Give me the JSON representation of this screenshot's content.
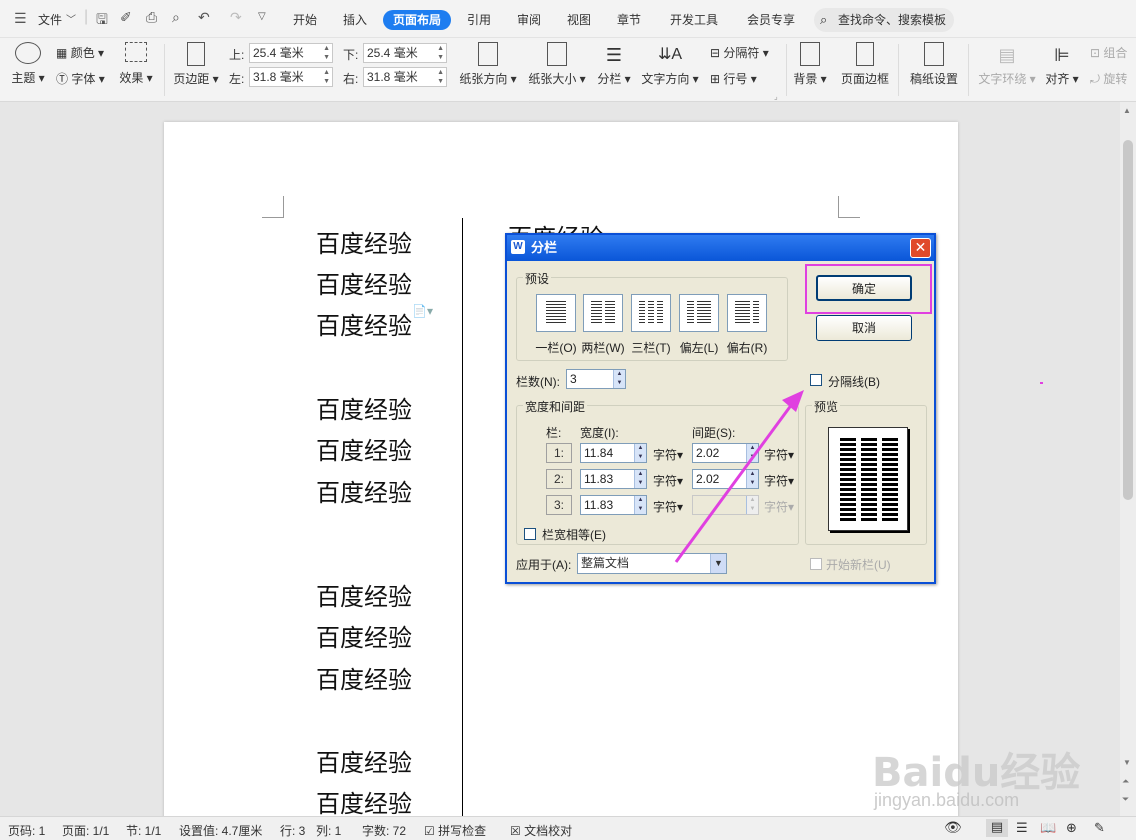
{
  "menubar": {
    "file": "文件",
    "tabs": [
      "开始",
      "插入",
      "页面布局",
      "引用",
      "审阅",
      "视图",
      "章节",
      "开发工具",
      "会员专享"
    ],
    "search_placeholder": "查找命令、搜索模板"
  },
  "ribbon": {
    "theme": "主题",
    "colors": "颜色",
    "fonts": "字体",
    "effects": "效果",
    "margins": "页边距",
    "top_label": "上:",
    "top_value": "25.4 毫米",
    "bottom_label": "下:",
    "bottom_value": "25.4 毫米",
    "left_label": "左:",
    "left_value": "31.8 毫米",
    "right_label": "右:",
    "right_value": "31.8 毫米",
    "orientation": "纸张方向",
    "size": "纸张大小",
    "columns": "分栏",
    "text_direction": "文字方向",
    "breaks": "分隔符",
    "line_numbers": "行号",
    "background": "背景",
    "page_borders": "页面边框",
    "draft_settings": "稿纸设置",
    "text_wrap": "文字环绕",
    "align": "对齐",
    "group": "组合",
    "rotate": "旋转"
  },
  "document": {
    "lines": [
      "百度经验",
      "百度经验",
      "百度经验",
      "百度经验",
      "百度经验",
      "百度经验",
      "百度经验",
      "百度经验",
      "百度经验",
      "百度经验",
      "百度经验"
    ],
    "col2_partial": "百度经验"
  },
  "dialog": {
    "title": "分栏",
    "close": "✕",
    "presets_label": "预设",
    "presets": [
      "一栏(O)",
      "两栏(W)",
      "三栏(T)",
      "偏左(L)",
      "偏右(R)"
    ],
    "ok": "确定",
    "cancel": "取消",
    "num_cols_label": "栏数(N):",
    "num_cols": "3",
    "separator_label": "分隔线(B)",
    "width_spacing_label": "宽度和间距",
    "col_header": "栏:",
    "width_header": "宽度(I):",
    "spacing_header": "间距(S):",
    "rows": [
      {
        "n": "1:",
        "width": "11.84",
        "spacing": "2.02"
      },
      {
        "n": "2:",
        "width": "11.83",
        "spacing": "2.02"
      },
      {
        "n": "3:",
        "width": "11.83",
        "spacing": ""
      }
    ],
    "unit": "字符",
    "equal_width_label": "栏宽相等(E)",
    "preview_label": "预览",
    "apply_to_label": "应用于(A):",
    "apply_to_value": "整篇文档",
    "new_column_label": "开始新栏(U)"
  },
  "status": {
    "page_num": "页码: 1",
    "pages": "页面: 1/1",
    "section": "节: 1/1",
    "position": "设置值: 4.7厘米",
    "row": "行: 3",
    "col": "列: 1",
    "words": "字数: 72",
    "spell": "拼写检查",
    "proof": "文档校对"
  },
  "watermark": {
    "brand": "Baidu经验",
    "url": "jingyan.baidu.com"
  },
  "colors": {
    "accent": "#1e7df0",
    "highlight": "#e040e0",
    "dialog_title": "#0a56d8"
  }
}
